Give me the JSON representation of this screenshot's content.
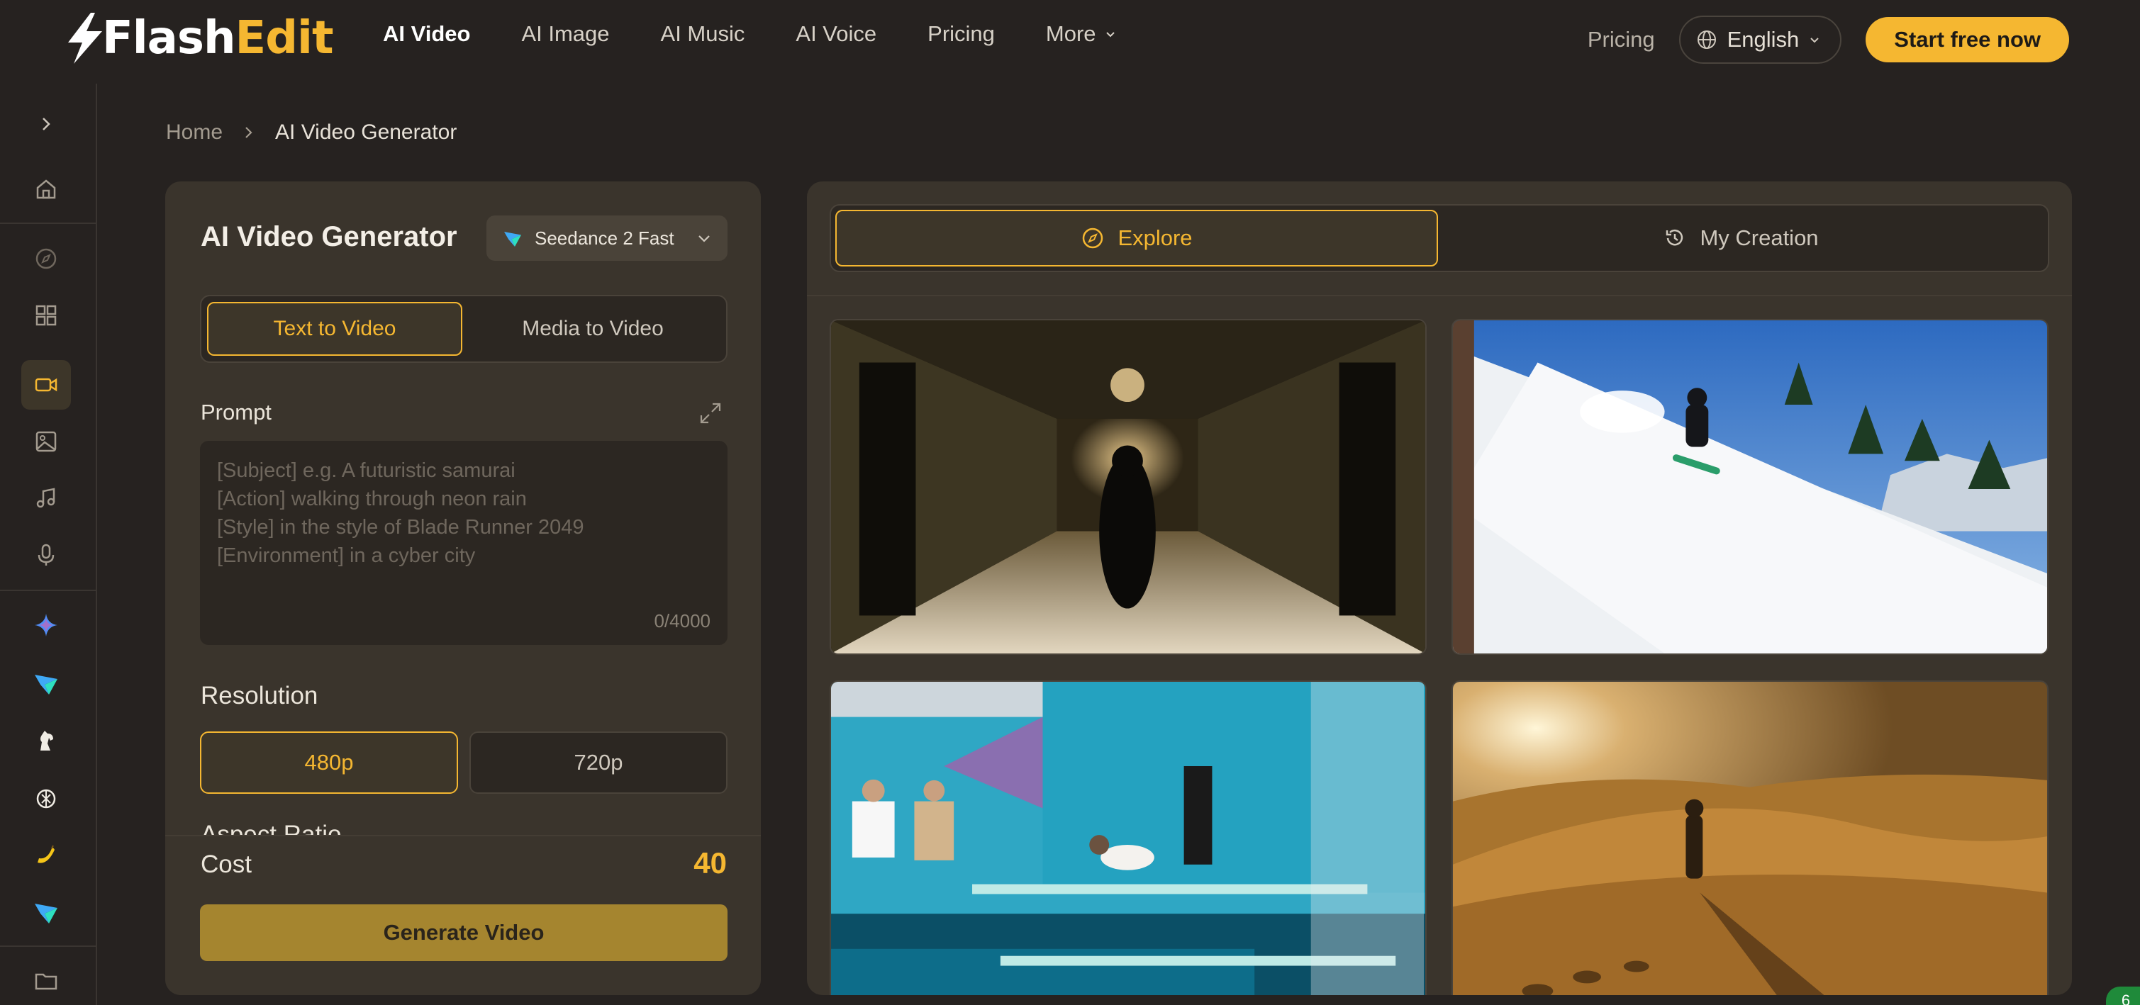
{
  "brand": {
    "flash": "Flash",
    "edit": "Edit",
    "accent": "#f5b731"
  },
  "nav": {
    "items": [
      {
        "label": "AI Video",
        "active": true
      },
      {
        "label": "AI Image"
      },
      {
        "label": "AI Music"
      },
      {
        "label": "AI Voice"
      },
      {
        "label": "Pricing"
      },
      {
        "label": "More"
      }
    ]
  },
  "header_right": {
    "pricing": "Pricing",
    "language": "English",
    "cta": "Start free now"
  },
  "rail": {
    "icons": [
      "chevron-right-icon",
      "home-icon",
      "compass-icon",
      "grid-icon",
      "video-icon",
      "image-icon",
      "music-icon",
      "microphone-icon",
      "sparkle-icon",
      "seedance-icon",
      "horse-icon",
      "openai-icon",
      "banana-icon",
      "seedance-icon",
      "folder-icon"
    ]
  },
  "breadcrumb": {
    "home": "Home",
    "current": "AI Video Generator"
  },
  "generator": {
    "title": "AI Video Generator",
    "model": "Seedance 2 Fast",
    "modes": [
      "Text to Video",
      "Media to Video"
    ],
    "prompt_label": "Prompt",
    "prompt_placeholder": "[Subject] e.g. A futuristic samurai\n[Action] walking through neon rain\n[Style] in the style of Blade Runner 2049\n[Environment] in a cyber city",
    "prompt_count": "0/4000",
    "resolution_label": "Resolution",
    "resolutions": [
      "480p",
      "720p"
    ],
    "aspect_label": "Aspect Ratio",
    "cost_label": "Cost",
    "cost_value": "40",
    "generate": "Generate Video"
  },
  "gallery": {
    "tabs": [
      "Explore",
      "My Creation"
    ],
    "items": [
      "hallway-runner-video",
      "snowboarder-video",
      "diving-cat-video",
      "desert-walker-video"
    ]
  },
  "corner_badge": "6"
}
